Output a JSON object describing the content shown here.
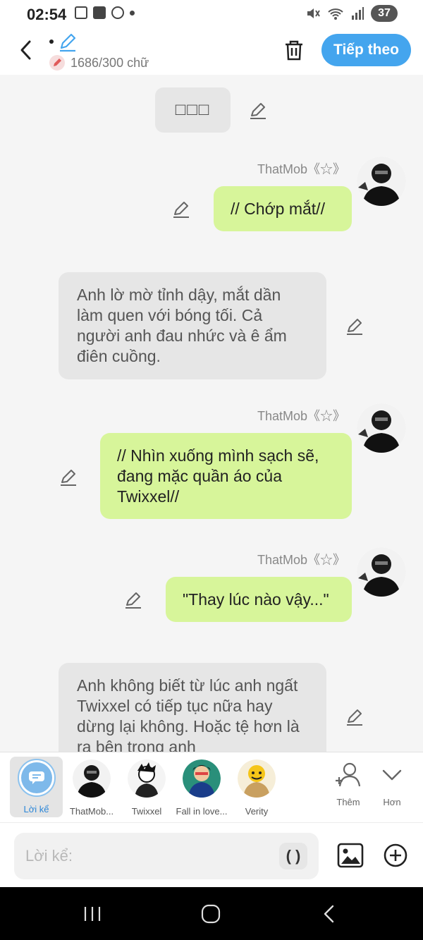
{
  "status": {
    "time": "02:54",
    "battery": "37"
  },
  "header": {
    "word_count": "1686/300 chữ",
    "next_label": "Tiếp theo"
  },
  "chat": {
    "placeholder_box": "□□□",
    "messages": [
      {
        "sender": "ThatMob《☆》",
        "text": "// Chớp mắt//"
      },
      {
        "text": "Anh lờ mờ tỉnh dậy, mắt dần làm quen với bóng tối. Cả người anh đau nhức và ê ẩm điên cuồng."
      },
      {
        "sender": "ThatMob《☆》",
        "text": "// Nhìn xuống mình sạch sẽ, đang mặc quần áo của Twixxel//"
      },
      {
        "sender": "ThatMob《☆》",
        "text": "\"Thay lúc nào vậy...\""
      },
      {
        "text": "Anh không biết từ lúc anh ngất Twixxel có tiếp tục nữa hay dừng lại không. Hoặc tệ hơn là ra bên trong anh"
      }
    ]
  },
  "characters": {
    "narrator_label": "Lời kể",
    "items": [
      "ThatMob...",
      "Twixxel",
      "Fall in love...",
      "Verity"
    ],
    "add_label": "Thêm",
    "more_label": "Hơn"
  },
  "input": {
    "placeholder": "Lời kể:",
    "paren": "( )"
  },
  "colors": {
    "accent": "#44a5ee",
    "user_bubble": "#d7f59a",
    "narration_bubble": "#e6e6e6"
  }
}
